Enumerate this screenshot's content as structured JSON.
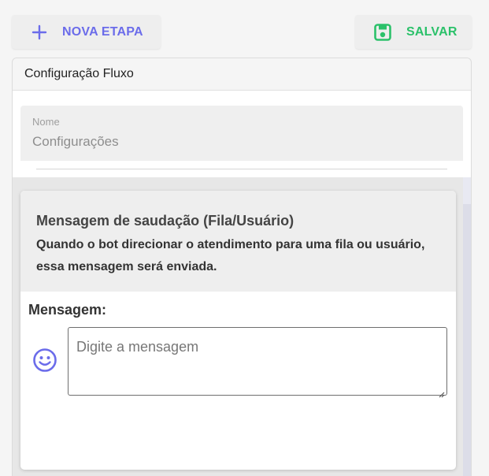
{
  "toolbar": {
    "new_step_label": "NOVA ETAPA",
    "save_label": "SALVAR",
    "new_step_icon": "plus-icon",
    "save_icon": "floppy-disk-icon"
  },
  "panel": {
    "title": "Configuração Fluxo",
    "name_field": {
      "label": "Nome",
      "value": "Configurações"
    }
  },
  "card": {
    "title": "Mensagem de saudação (Fila/Usuário)",
    "description": "Quando o bot direcionar o atendimento para uma fila ou usuário, essa mensagem será enviada.",
    "message_label": "Mensagem:",
    "message_placeholder": "Digite a mensagem",
    "emoji_icon": "smiley-face-icon"
  },
  "colors": {
    "primary": "#6b6cea",
    "success": "#2bc16a",
    "background": "#f5f5f5"
  }
}
